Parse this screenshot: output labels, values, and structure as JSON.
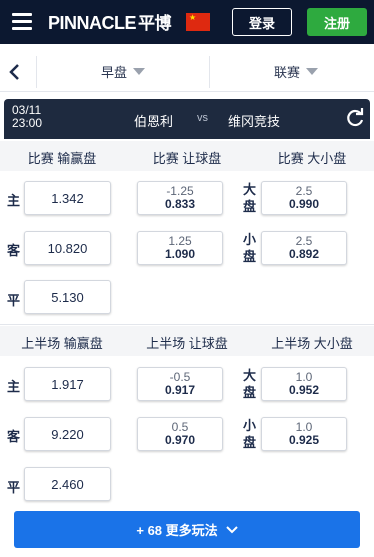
{
  "header": {
    "menu_icon": "hamburger-icon",
    "logo_text": "PINNACLE",
    "logo_cn": "平博",
    "flag": "china-flag-icon",
    "login": "登录",
    "register": "注册"
  },
  "filter": {
    "period": "早盘",
    "league": "联赛"
  },
  "match": {
    "date": "03/11",
    "time": "23:00",
    "home": "伯恩利",
    "vs": "vs",
    "away": "维冈竞技"
  },
  "full": {
    "headers": [
      "比赛 输赢盘",
      "比赛 让球盘",
      "比赛 大小盘"
    ],
    "moneyline": [
      {
        "label": "主",
        "odds": "1.342"
      },
      {
        "label": "客",
        "odds": "10.820"
      },
      {
        "label": "平",
        "odds": "5.130"
      }
    ],
    "handicap": [
      {
        "line": "-1.25",
        "odds": "0.833"
      },
      {
        "line": "1.25",
        "odds": "1.090"
      }
    ],
    "totals": [
      {
        "label": "大盘",
        "line": "2.5",
        "odds": "0.990"
      },
      {
        "label": "小盘",
        "line": "2.5",
        "odds": "0.892"
      }
    ]
  },
  "half": {
    "headers": [
      "上半场 输赢盘",
      "上半场 让球盘",
      "上半场 大小盘"
    ],
    "moneyline": [
      {
        "label": "主",
        "odds": "1.917"
      },
      {
        "label": "客",
        "odds": "9.220"
      },
      {
        "label": "平",
        "odds": "2.460"
      }
    ],
    "handicap": [
      {
        "line": "-0.5",
        "odds": "0.917"
      },
      {
        "line": "0.5",
        "odds": "0.970"
      }
    ],
    "totals": [
      {
        "label": "大盘",
        "line": "1.0",
        "odds": "0.952"
      },
      {
        "label": "小盘",
        "line": "1.0",
        "odds": "0.925"
      }
    ]
  },
  "more": "+ 68 更多玩法",
  "colors": {
    "navy": "#0c1830",
    "green": "#2eaa3f",
    "blue": "#1a73e8",
    "match_bar": "#1e2a3f"
  }
}
